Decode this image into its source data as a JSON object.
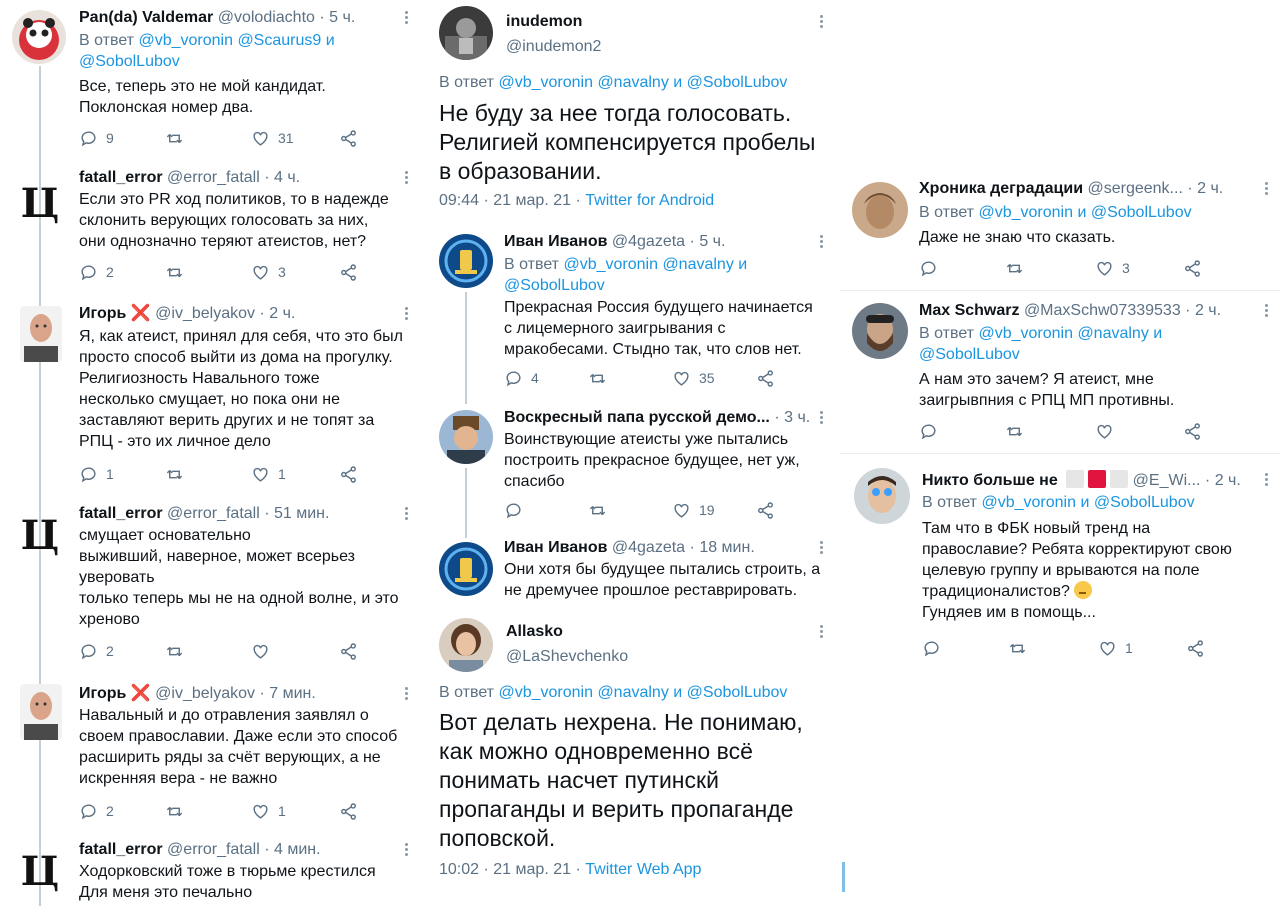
{
  "col1": {
    "t1": {
      "name": "Pan(da) Valdemar",
      "handle": "@volodiachto",
      "time": "5 ч.",
      "reply_prefix": "В ответ",
      "mention1": "@vb_voronin",
      "mention2": "@Scaurus9",
      "and": "и",
      "mention3": "@SobolLubov",
      "text": "Все, теперь это не мой кандидат.\nПоклонская номер два.",
      "replies": "9",
      "retweets": "",
      "likes": "31"
    },
    "t2": {
      "avatar_letter": "Ц",
      "name": "fatall_error",
      "handle": "@error_fatall",
      "time": "4 ч.",
      "text": "Если это PR ход политиков, то в надежде\nсклонить верующих голосовать за них,\nони однозначно теряют атеистов, нет?",
      "replies": "2",
      "retweets": "",
      "likes": "3"
    },
    "t3": {
      "name": "Игорь",
      "badge": "❌",
      "handle": "@iv_belyakov",
      "time": "2 ч.",
      "text": "Я, как атеист, принял для себя, что это был\nпросто способ выйти из дома на прогулку.\nРелигиозность Навального тоже\nнесколько смущает, но пока они не\nзаставляют верить других и не топят за\nРПЦ - это их личное дело",
      "replies": "1",
      "retweets": "",
      "likes": "1"
    },
    "t4": {
      "avatar_letter": "Ц",
      "name": "fatall_error",
      "handle": "@error_fatall",
      "time": "51 мин.",
      "text": "смущает основательно\nвыживший, наверное, может всерьез\nуверовать\nтолько теперь мы не на одной волне, и это\nхреново",
      "replies": "2",
      "retweets": "",
      "likes": ""
    },
    "t5": {
      "name": "Игорь",
      "badge": "❌",
      "handle": "@iv_belyakov",
      "time": "7 мин.",
      "text": "Навальный и до отравления заявлял о\nсвоем православии. Даже если это способ\nрасширить ряды за счёт верующих, а не\nискренняя вера - не важно",
      "replies": "2",
      "retweets": "",
      "likes": "1"
    },
    "t6": {
      "avatar_letter": "Ц",
      "name": "fatall_error",
      "handle": "@error_fatall",
      "time": "4 мин.",
      "text": "Ходорковский тоже в тюрьме крестился\nДля меня это печально"
    }
  },
  "col2": {
    "main1": {
      "name": "inudemon",
      "handle": "@inudemon2",
      "reply_prefix": "В ответ",
      "mention1": "@vb_voronin",
      "mention2": "@navalny",
      "and": "и",
      "mention3": "@SobolLubov",
      "text": "Не буду за нее тогда голосовать.\nРелигией компенсируется пробелы\nв образовании.",
      "time": "09:44",
      "date": "21 мар. 21",
      "app": "Twitter for Android"
    },
    "r1": {
      "name": "Иван Иванов",
      "handle": "@4gazeta",
      "time": "5 ч.",
      "reply_prefix": "В ответ",
      "mention1": "@vb_voronin",
      "mention2": "@navalny",
      "and": "и",
      "mention3": "@SobolLubov",
      "text": "Прекрасная Россия будущего начинается\nс лицемерного заигрывания с\nмракобесами. Стыдно так, что слов нет.",
      "replies": "4",
      "retweets": "",
      "likes": "35"
    },
    "r2": {
      "name": "Воскресный папа русской демо...",
      "handle": "",
      "time": "3 ч.",
      "text": "Воинствующие атеисты уже пытались\nпостроить прекрасное будущее, нет уж,\nспасибо",
      "replies": "",
      "retweets": "",
      "likes": "19"
    },
    "r3": {
      "name": "Иван Иванов",
      "handle": "@4gazeta",
      "time": "18 мин.",
      "text": "Они хотя бы будущее пытались строить, а\nне дремучее прошлое реставрировать."
    },
    "main2": {
      "name": "Allasko",
      "handle": "@LaShevchenko",
      "reply_prefix": "В ответ",
      "mention1": "@vb_voronin",
      "mention2": "@navalny",
      "and": "и",
      "mention3": "@SobolLubov",
      "text": "Вот делать нехрена. Не понимаю,\nкак можно одновременно всё\nпонимать насчет путинскй\nпропаганды и верить пропаганде\nпоповской.",
      "time": "10:02",
      "date": "21 мар. 21",
      "app": "Twitter Web App"
    }
  },
  "col3": {
    "t1": {
      "name": "Хроника деградации",
      "handle": "@sergeenk...",
      "time": "2 ч.",
      "reply_prefix": "В ответ",
      "mention1": "@vb_voronin",
      "and": "и",
      "mention2": "@SobolLubov",
      "text": "Даже не знаю что сказать.",
      "replies": "",
      "retweets": "",
      "likes": "3"
    },
    "t2": {
      "name": "Max Schwarz",
      "handle": "@MaxSchw07339533",
      "time": "2 ч.",
      "reply_prefix": "В ответ",
      "mention1": "@vb_voronin",
      "mention2": "@navalny",
      "and": "и",
      "mention3": "@SobolLubov",
      "text": "А нам это зачем? Я атеист, мне\nзаигрывпния с РПЦ МП противны.",
      "replies": "",
      "retweets": "",
      "likes": ""
    },
    "t3": {
      "name": "Никто больше не",
      "handle": "@E_Wi...",
      "time": "2 ч.",
      "reply_prefix": "В ответ",
      "mention1": "@vb_voronin",
      "and": "и",
      "mention2": "@SobolLubov",
      "text_before_emoji": "Там что в ФБК новый тренд на\nправославие? Ребята корректируют свою\nцелевую группу и врываются на поле\nтрадиционалистов? ",
      "text_after_emoji": "Гундяев им в помощь...",
      "replies": "",
      "retweets": "",
      "likes": "1"
    }
  },
  "separator_dot": "·",
  "colors": {
    "link": "#1b95e0",
    "muted": "#5b7083",
    "text": "#0f1419",
    "divider": "#e6ecf0"
  },
  "icons": [
    "reply-icon",
    "retweet-icon",
    "like-icon",
    "share-icon",
    "more-icon"
  ]
}
